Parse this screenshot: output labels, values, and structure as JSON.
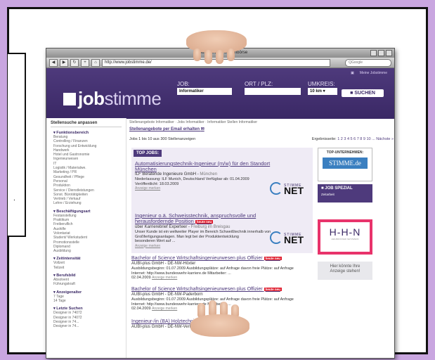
{
  "browser": {
    "window_title": "Jobstimme.de – Stellenbörse",
    "url": "http://www.jobstimme.de/",
    "search_placeholder": "Google"
  },
  "site": {
    "top_link": "Meine Jobstimme",
    "logo_bold": "job",
    "logo_light": "stimme",
    "job_label": "JOB:",
    "job_value": "Informatiker",
    "place_label": "ORT / PLZ:",
    "radius_label": "UMKREIS:",
    "radius_value": "10 km",
    "search_button": "SUCHEN"
  },
  "sidebar": {
    "heading": "Stellensuche anpassen",
    "sections": [
      {
        "title": "Funktionsbereich",
        "items": [
          "Beratung",
          "Controlling / Finanzen",
          "Forschung und Entwicklung",
          "Handwerk",
          "Hotel und Gastronomie",
          "Ingenieurwesen",
          "IT",
          "Logistik / Materialwe.",
          "Marketing / PR",
          "Gesundheit / Pflege",
          "Personal",
          "Produktion",
          "Service / Dienstleistungen",
          "Sonst. Bürotätigkeiten",
          "Vertrieb / Verkauf",
          "Lehre / Erziehung"
        ]
      },
      {
        "title": "Beschäftigungsart",
        "items": [
          "Festanstellung",
          "Praktikum",
          "Freiberuflich",
          "Aushilfe",
          "Volontariat",
          "Student/ Werkstudent",
          "Promotionsstelle",
          "Diplomand",
          "Ausbildung"
        ]
      },
      {
        "title": "Zeitintensität",
        "items": [
          "Vollzeit",
          "Teilzeit"
        ]
      },
      {
        "title": "Berufsbild",
        "items": [
          "Absolvent",
          "Führungskraft"
        ]
      },
      {
        "title": "Anzeigenalter",
        "items": [
          "7 Tage",
          "14 Tage"
        ]
      },
      {
        "title": "Letzte Suchen",
        "items": [
          "Designer in 74072",
          "Designer in 74072",
          "Designer in 74...",
          "Designer in 74..."
        ]
      }
    ]
  },
  "main": {
    "breadcrumb": "Stellenangebote Informatiker · Jobs Informatiker · Informatiker Stellen Informatiker",
    "email_link": "Stellenangebote per Email erhalten",
    "result_count": "Jobs 1 bis 10 aus 300 Stellenanzeigen",
    "pages_label": "Ergebnisseite:",
    "pages": "1 2 3 4 5 6 7 8 9 10 ...",
    "next": "Nächste »",
    "top_jobs_label": "TOP JOBS:",
    "top_jobs": [
      {
        "title": "Automatisierungstechnik-Ingenieur (m/w) für den Standort München",
        "company": "ILF Beratende Ingenieure GmbH",
        "location": "München",
        "meta1": "Niederlassung: ILF Munich, Deutschland Verfügbar ab: 01.04.2009",
        "meta2": "Veröffentlicht: 18.03.2009",
        "more": "Anzeige merken",
        "logo_top": "STIMME",
        "logo_main": "NET"
      },
      {
        "title": "Ingenieur o.ä. Schweisstechnik, anspruchsvolle und herausfordernde Position",
        "badge": "heute neu",
        "company": "über Karrierebrief Experteer",
        "location": "Freiburg im Breisgau",
        "meta1": "Unser Kunde ist ein weltweiter Player im Bereich Schweißtechnik innerhalb von Großfertigungsanlagen. Man legt bei der Produktentwicklung",
        "meta2": "besonderen Wert auf ...",
        "more": "Anzeige merken",
        "logo_top": "STIMME",
        "logo_main": "NET"
      }
    ],
    "jobs": [
      {
        "title": "Bachelor of Science Wirtschaftsingenieurwesen plus Offizier",
        "badge": "heute neu",
        "company": "AUBI-plus GmbH - DE-NW-Höxter",
        "meta1": "Ausbildungsbeginn: 01.07.2009 Ausbildungsplätze: auf Anfrage davon freie Plätze: auf Anfrage",
        "meta2": "Internet: http://www.bundeswehr-karriere.de Mitarbeiter: ...",
        "date": "02.04.2009",
        "more": "Anzeige merken"
      },
      {
        "title": "Bachelor of Science Wirtschaftsingenieurwesen plus Offizier",
        "badge": "heute neu",
        "company": "AUBI-plus GmbH - DE-NW-Paderborn",
        "meta1": "Ausbildungsbeginn: 01.07.2009 Ausbildungsplätze: auf Anfrage davon freie Plätze: auf Anfrage",
        "meta2": "Internet: http://www.bundeswehr-karriere.de Mitarbeiter: ...",
        "date": "02.04.2009",
        "more": "Anzeige merken"
      },
      {
        "title": "Ingenieur-/in (BA) Holztechnik",
        "company": "AUBI-plus GmbH - DE-NW-Verl"
      }
    ]
  },
  "right": {
    "top_companies": "TOP-UNTERNEHMEN:",
    "stimme_logo": "STIMME.de",
    "job_spezial": "JOB SPEZIAL",
    "zeitarbeit": "Zeitarbeit",
    "hn_logo": "H-H-N",
    "hn_sub": "HEILBRONNER NETZWERK",
    "ad_line1": "Hier könnte Ihre",
    "ad_line2": "Anzeige stehen!"
  },
  "colors": {
    "accent": "#4e3a7c",
    "highlight": "#e8336b",
    "background": "#c9a6e0"
  }
}
